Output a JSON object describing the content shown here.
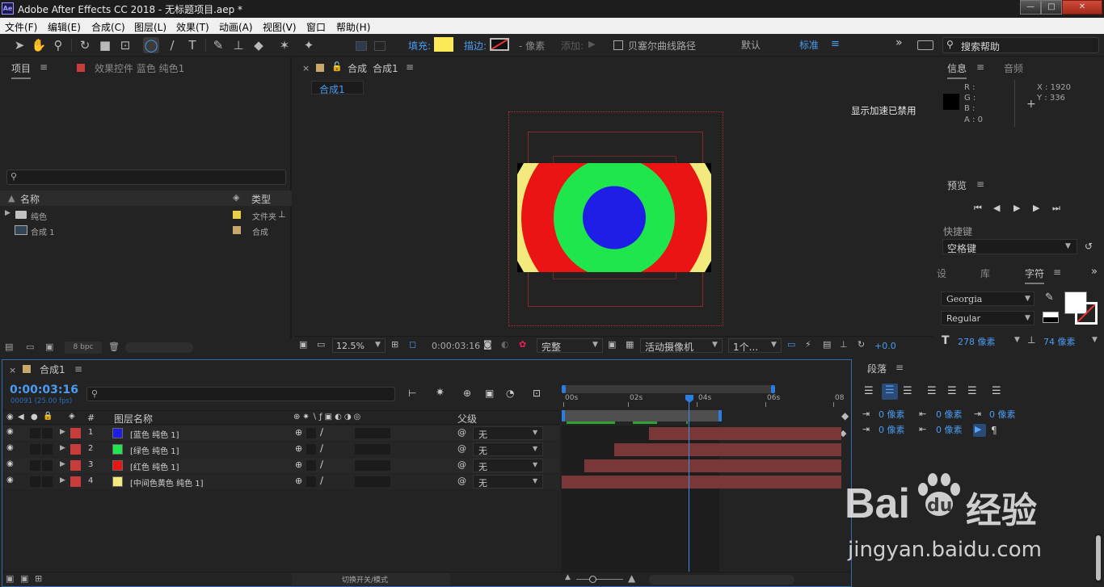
{
  "app": {
    "logo": "Ae",
    "title": "Adobe After Effects CC 2018 - 无标题项目.aep *",
    "min_label": "—",
    "max_label": "□",
    "close_label": "✕"
  },
  "menu": [
    "文件(F)",
    "编辑(E)",
    "合成(C)",
    "图层(L)",
    "效果(T)",
    "动画(A)",
    "视图(V)",
    "窗口",
    "帮助(H)"
  ],
  "toolbar": {
    "fill_label": "填充:",
    "stroke_label": "描边:",
    "pixel_label": "- 像素",
    "add_label": "添加:",
    "bezier_label": "贝塞尔曲线路径",
    "workspace_default": "默认",
    "workspace_standard": "标准",
    "more_label": "»",
    "search_placeholder": "搜索帮助",
    "fill_color": "#fbe95a"
  },
  "project_panel": {
    "tab_project": "项目",
    "tab_effects": "效果控件 蓝色 纯色1",
    "search_placeholder": "",
    "col_name": "名称",
    "col_type": "类型",
    "items": [
      {
        "name": "纯色",
        "type": "文件夹",
        "label_color": "#e8d142"
      },
      {
        "name": "合成 1",
        "type": "合成",
        "label_color": "#c8a86a"
      }
    ],
    "bpc": "8 bpc"
  },
  "comp_panel": {
    "title_prefix": "合成",
    "title_name": "合成1",
    "tab": "合成1",
    "accel_msg": "显示加速已禁用",
    "zoom": "12.5%",
    "timecode": "0:00:03:16",
    "resolution": "完整",
    "camera": "活动摄像机",
    "views": "1个...",
    "exposure": "+0.0"
  },
  "info_panel": {
    "tab_info": "信息",
    "tab_audio": "音频",
    "r": "R :",
    "g": "G :",
    "b": "B :",
    "a": "A :  0",
    "x": "X : 1920",
    "y": "Y : 336"
  },
  "preview_panel": {
    "title": "预览",
    "shortcut_label": "快捷键",
    "shortcut_value": "空格键"
  },
  "char_panel": {
    "tab_settings": "设",
    "tab_library": "库",
    "tab_char": "字符",
    "font": "Georgia",
    "style": "Regular",
    "size": "278 像素",
    "leading": "74 像素"
  },
  "para_panel": {
    "title": "段落",
    "indent_left": "0 像素",
    "indent_first": "0 像素",
    "space_before": "0 像素",
    "space_after": "0 像素",
    "indent_right": "0 像素"
  },
  "timeline": {
    "tab": "合成1",
    "timecode": "0:00:03:16",
    "frame_info": "00091 (25.00 fps)",
    "col_layer_name": "图层名称",
    "col_parent": "父级",
    "col_num": "#",
    "ruler": [
      "00s",
      "02s",
      "04s",
      "06s",
      "08"
    ],
    "toggle_label": "切换开关/模式",
    "layers": [
      {
        "num": "1",
        "name": "[蓝色 纯色 1]",
        "color": "#1e1ee6",
        "parent": "无"
      },
      {
        "num": "2",
        "name": "[绿色 纯色 1]",
        "color": "#1ee64c",
        "parent": "无"
      },
      {
        "num": "3",
        "name": "[红色 纯色 1]",
        "color": "#ea1414",
        "parent": "无"
      },
      {
        "num": "4",
        "name": "[中间色黄色 纯色 1]",
        "color": "#f2ea7c",
        "parent": "无"
      }
    ]
  },
  "watermark": {
    "brand": "Bai",
    "brand2": "du",
    "cn": "经验",
    "url": "jingyan.baidu.com"
  }
}
